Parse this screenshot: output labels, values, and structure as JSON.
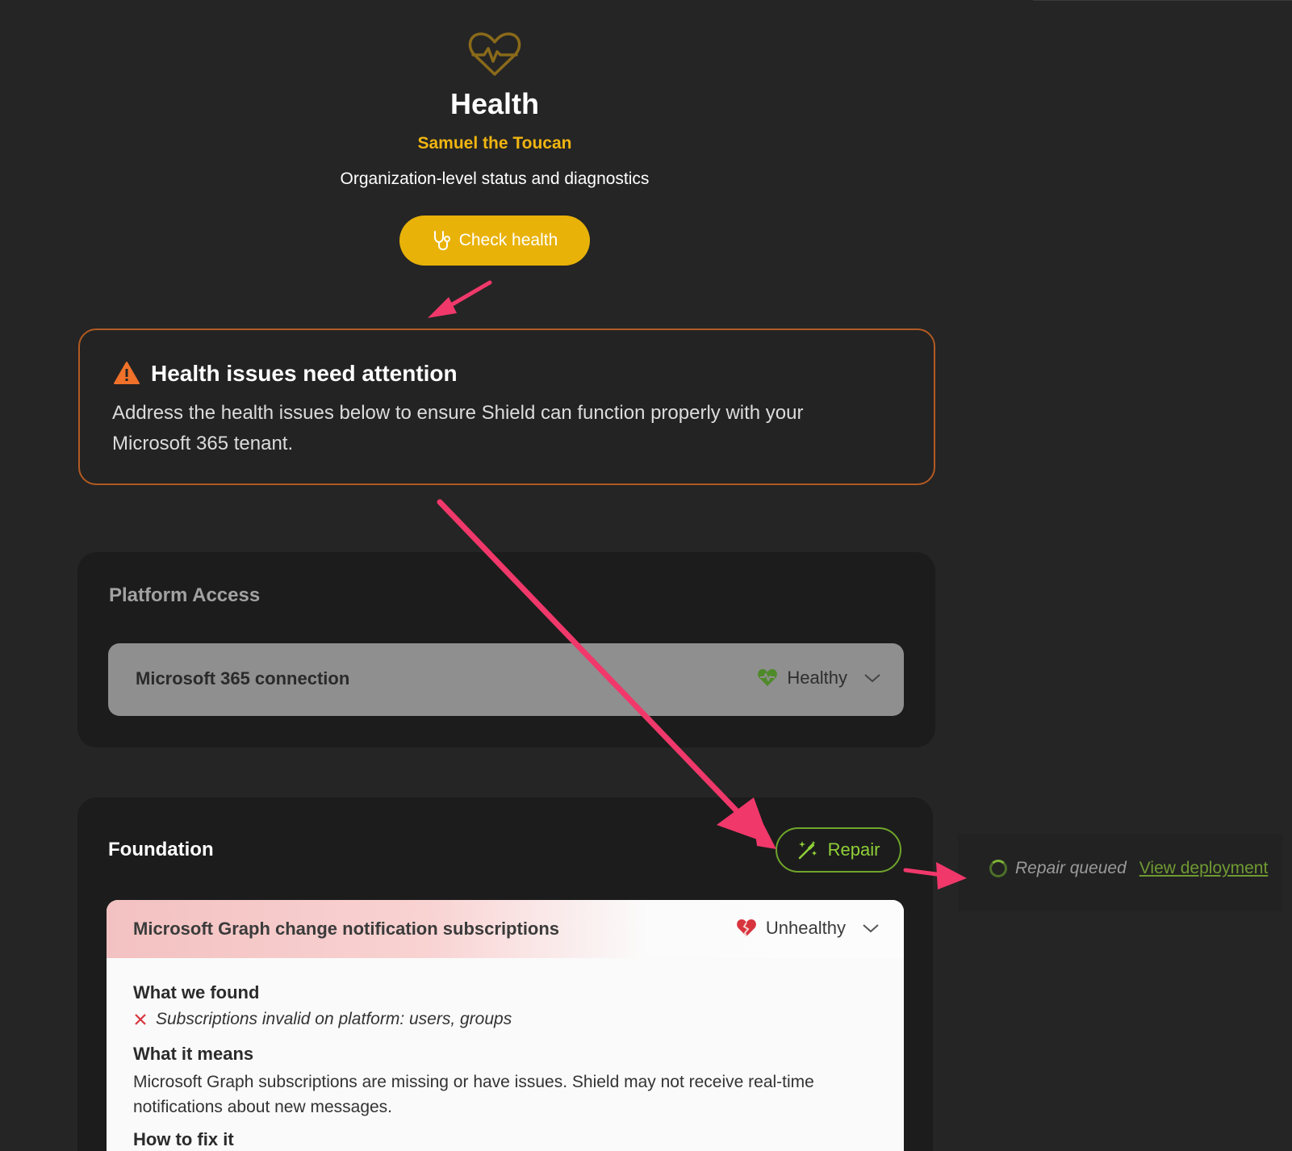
{
  "header": {
    "icon": "heart-pulse-icon",
    "title": "Health",
    "org_name": "Samuel the Toucan",
    "subtitle": "Organization-level status and diagnostics",
    "check_button_label": "Check health",
    "check_button_icon": "stethoscope-icon"
  },
  "alert": {
    "icon": "warning-triangle-icon",
    "title": "Health issues need attention",
    "text": "Address the health issues below to ensure Shield can function properly with your Microsoft 365 tenant."
  },
  "platform_access": {
    "title": "Platform Access",
    "rows": [
      {
        "label": "Microsoft 365 connection",
        "status": "Healthy",
        "status_icon": "heart-pulse-icon"
      }
    ]
  },
  "foundation": {
    "title": "Foundation",
    "repair_label": "Repair",
    "repair_icon": "magic-wand-icon",
    "card": {
      "title": "Microsoft Graph change notification subscriptions",
      "status": "Unhealthy",
      "status_icon": "broken-heart-icon",
      "found_heading": "What we found",
      "found_item": "Subscriptions invalid on platform: users, groups",
      "means_heading": "What it means",
      "means_text": "Microsoft Graph subscriptions are missing or have issues. Shield may not receive real-time notifications about new messages.",
      "fix_heading": "How to fix it"
    }
  },
  "repair_status": {
    "text": "Repair queued",
    "link": "View deployment"
  },
  "colors": {
    "accent_yellow": "#e9b208",
    "alert_border": "#b25a22",
    "healthy_green": "#5c9a2f",
    "unhealthy_red": "#d8343e",
    "annotation_pink": "#f0386b"
  }
}
